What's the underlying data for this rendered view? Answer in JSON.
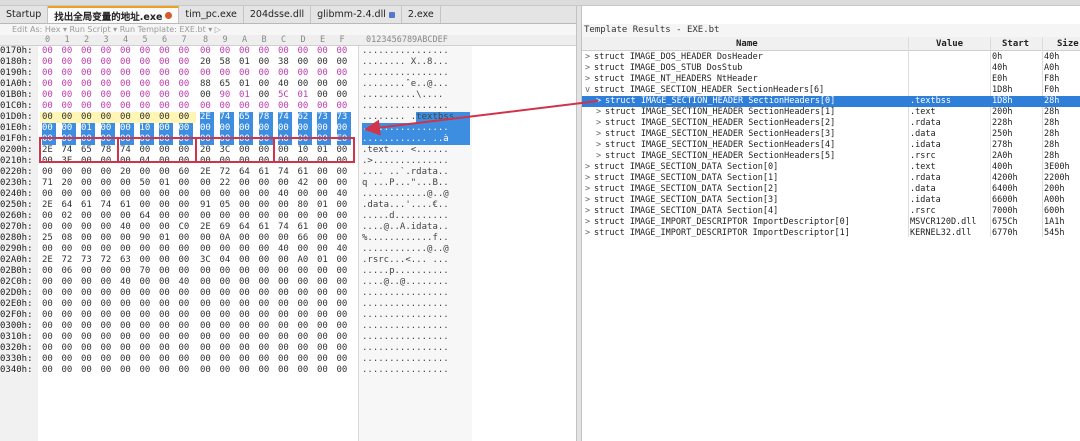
{
  "tabs": [
    {
      "label": "Startup",
      "active": false
    },
    {
      "label": "找出全局变量的地址.exe",
      "active": true
    },
    {
      "label": "tim_pc.exe",
      "active": false
    },
    {
      "label": "204dsse.dll",
      "active": false
    },
    {
      "label": "glibmm-2.4.dll",
      "active": false
    },
    {
      "label": "2.exe",
      "active": false
    }
  ],
  "edit_line": "Edit As: Hex ▾   Run Script ▾   Run Template: EXE.bt ▾  ▷",
  "hex_columns": [
    "0",
    "1",
    "2",
    "3",
    "4",
    "5",
    "6",
    "7",
    "8",
    "9",
    "A",
    "B",
    "C",
    "D",
    "E",
    "F"
  ],
  "ascii_header": "0123456789ABCDEF",
  "hex_rows": [
    {
      "addr": "0170h:",
      "bytes": [
        "00",
        "00",
        "00",
        "00",
        "00",
        "00",
        "00",
        "00",
        "00",
        "00",
        "00",
        "00",
        "00",
        "00",
        "00",
        "00"
      ],
      "ascii": "................"
    },
    {
      "addr": "0180h:",
      "bytes": [
        "00",
        "00",
        "00",
        "00",
        "00",
        "00",
        "00",
        "00",
        "20",
        "58",
        "01",
        "00",
        "38",
        "00",
        "00",
        "00"
      ],
      "ascii": "........ X..8..."
    },
    {
      "addr": "0190h:",
      "bytes": [
        "00",
        "00",
        "00",
        "00",
        "00",
        "00",
        "00",
        "00",
        "00",
        "00",
        "00",
        "00",
        "00",
        "00",
        "00",
        "00"
      ],
      "ascii": "................"
    },
    {
      "addr": "01A0h:",
      "bytes": [
        "00",
        "00",
        "00",
        "00",
        "00",
        "00",
        "00",
        "00",
        "88",
        "65",
        "01",
        "00",
        "40",
        "00",
        "00",
        "00"
      ],
      "ascii": "........ˆe..@..."
    },
    {
      "addr": "01B0h:",
      "bytes": [
        "00",
        "00",
        "00",
        "00",
        "00",
        "00",
        "00",
        "00",
        "00",
        "90",
        "01",
        "00",
        "5C",
        "01",
        "00",
        "00"
      ],
      "ascii": "..........\\...."
    },
    {
      "addr": "01C0h:",
      "bytes": [
        "00",
        "00",
        "00",
        "00",
        "00",
        "00",
        "00",
        "00",
        "00",
        "00",
        "00",
        "00",
        "00",
        "00",
        "00",
        "00"
      ],
      "ascii": "................"
    },
    {
      "addr": "01D0h:",
      "bytes": [
        "00",
        "00",
        "00",
        "00",
        "00",
        "00",
        "00",
        "00",
        "2E",
        "74",
        "65",
        "78",
        "74",
        "62",
        "73",
        "73"
      ],
      "ascii": "........ .textbss"
    },
    {
      "addr": "01E0h:",
      "bytes": [
        "00",
        "00",
        "01",
        "00",
        "00",
        "10",
        "00",
        "00",
        "00",
        "00",
        "00",
        "00",
        "00",
        "00",
        "00",
        "00"
      ],
      "ascii": "................"
    },
    {
      "addr": "01F0h:",
      "bytes": [
        "00",
        "00",
        "00",
        "00",
        "00",
        "00",
        "00",
        "00",
        "00",
        "00",
        "00",
        "00",
        "A0",
        "00",
        "00",
        "E0"
      ],
      "ascii": "............ ..à"
    },
    {
      "addr": "0200h:",
      "bytes": [
        "2E",
        "74",
        "65",
        "78",
        "74",
        "00",
        "00",
        "00",
        "20",
        "3C",
        "00",
        "00",
        "00",
        "10",
        "01",
        "00"
      ],
      "ascii": ".text... <......"
    },
    {
      "addr": "0210h:",
      "bytes": [
        "00",
        "3E",
        "00",
        "00",
        "00",
        "04",
        "00",
        "00",
        "00",
        "00",
        "00",
        "00",
        "00",
        "00",
        "00",
        "00"
      ],
      "ascii": ".>.............."
    },
    {
      "addr": "0220h:",
      "bytes": [
        "00",
        "00",
        "00",
        "00",
        "20",
        "00",
        "00",
        "60",
        "2E",
        "72",
        "64",
        "61",
        "74",
        "61",
        "00",
        "00"
      ],
      "ascii": ".... ..`.rdata.."
    },
    {
      "addr": "0230h:",
      "bytes": [
        "71",
        "20",
        "00",
        "00",
        "00",
        "50",
        "01",
        "00",
        "00",
        "22",
        "00",
        "00",
        "00",
        "42",
        "00",
        "00"
      ],
      "ascii": "q ...P...\"...B.."
    },
    {
      "addr": "0240h:",
      "bytes": [
        "00",
        "00",
        "00",
        "00",
        "00",
        "00",
        "00",
        "00",
        "00",
        "00",
        "00",
        "00",
        "40",
        "00",
        "00",
        "40"
      ],
      "ascii": "............@..@"
    },
    {
      "addr": "0250h:",
      "bytes": [
        "2E",
        "64",
        "61",
        "74",
        "61",
        "00",
        "00",
        "00",
        "91",
        "05",
        "00",
        "00",
        "00",
        "80",
        "01",
        "00"
      ],
      "ascii": ".data...'....€.."
    },
    {
      "addr": "0260h:",
      "bytes": [
        "00",
        "02",
        "00",
        "00",
        "00",
        "64",
        "00",
        "00",
        "00",
        "00",
        "00",
        "00",
        "00",
        "00",
        "00",
        "00"
      ],
      "ascii": ".....d.........."
    },
    {
      "addr": "0270h:",
      "bytes": [
        "00",
        "00",
        "00",
        "00",
        "40",
        "00",
        "00",
        "C0",
        "2E",
        "69",
        "64",
        "61",
        "74",
        "61",
        "00",
        "00"
      ],
      "ascii": "....@..À.idata.."
    },
    {
      "addr": "0280h:",
      "bytes": [
        "25",
        "08",
        "00",
        "00",
        "00",
        "90",
        "01",
        "00",
        "00",
        "0A",
        "00",
        "00",
        "00",
        "66",
        "00",
        "00"
      ],
      "ascii": "%............f.."
    },
    {
      "addr": "0290h:",
      "bytes": [
        "00",
        "00",
        "00",
        "00",
        "00",
        "00",
        "00",
        "00",
        "00",
        "00",
        "00",
        "00",
        "40",
        "00",
        "00",
        "40"
      ],
      "ascii": "............@..@"
    },
    {
      "addr": "02A0h:",
      "bytes": [
        "2E",
        "72",
        "73",
        "72",
        "63",
        "00",
        "00",
        "00",
        "3C",
        "04",
        "00",
        "00",
        "00",
        "A0",
        "01",
        "00"
      ],
      "ascii": ".rsrc...<... ..."
    },
    {
      "addr": "02B0h:",
      "bytes": [
        "00",
        "06",
        "00",
        "00",
        "00",
        "70",
        "00",
        "00",
        "00",
        "00",
        "00",
        "00",
        "00",
        "00",
        "00",
        "00"
      ],
      "ascii": ".....p.........."
    },
    {
      "addr": "02C0h:",
      "bytes": [
        "00",
        "00",
        "00",
        "00",
        "40",
        "00",
        "00",
        "40",
        "00",
        "00",
        "00",
        "00",
        "00",
        "00",
        "00",
        "00"
      ],
      "ascii": "....@..@........"
    },
    {
      "addr": "02D0h:",
      "bytes": [
        "00",
        "00",
        "00",
        "00",
        "00",
        "00",
        "00",
        "00",
        "00",
        "00",
        "00",
        "00",
        "00",
        "00",
        "00",
        "00"
      ],
      "ascii": "................"
    },
    {
      "addr": "02E0h:",
      "bytes": [
        "00",
        "00",
        "00",
        "00",
        "00",
        "00",
        "00",
        "00",
        "00",
        "00",
        "00",
        "00",
        "00",
        "00",
        "00",
        "00"
      ],
      "ascii": "................"
    },
    {
      "addr": "02F0h:",
      "bytes": [
        "00",
        "00",
        "00",
        "00",
        "00",
        "00",
        "00",
        "00",
        "00",
        "00",
        "00",
        "00",
        "00",
        "00",
        "00",
        "00"
      ],
      "ascii": "................"
    },
    {
      "addr": "0300h:",
      "bytes": [
        "00",
        "00",
        "00",
        "00",
        "00",
        "00",
        "00",
        "00",
        "00",
        "00",
        "00",
        "00",
        "00",
        "00",
        "00",
        "00"
      ],
      "ascii": "................"
    },
    {
      "addr": "0310h:",
      "bytes": [
        "00",
        "00",
        "00",
        "00",
        "00",
        "00",
        "00",
        "00",
        "00",
        "00",
        "00",
        "00",
        "00",
        "00",
        "00",
        "00"
      ],
      "ascii": "................"
    },
    {
      "addr": "0320h:",
      "bytes": [
        "00",
        "00",
        "00",
        "00",
        "00",
        "00",
        "00",
        "00",
        "00",
        "00",
        "00",
        "00",
        "00",
        "00",
        "00",
        "00"
      ],
      "ascii": "................"
    },
    {
      "addr": "0330h:",
      "bytes": [
        "00",
        "00",
        "00",
        "00",
        "00",
        "00",
        "00",
        "00",
        "00",
        "00",
        "00",
        "00",
        "00",
        "00",
        "00",
        "00"
      ],
      "ascii": "................"
    },
    {
      "addr": "0340h:",
      "bytes": [
        "00",
        "00",
        "00",
        "00",
        "00",
        "00",
        "00",
        "00",
        "00",
        "00",
        "00",
        "00",
        "00",
        "00",
        "00",
        "00"
      ],
      "ascii": "................"
    }
  ],
  "template_panel": {
    "title": "Template Results - EXE.bt",
    "columns": {
      "name": "Name",
      "value": "Value",
      "start": "Start",
      "size": "Size"
    },
    "rows": [
      {
        "caret": ">",
        "indent": 0,
        "name": "struct IMAGE_DOS_HEADER DosHeader",
        "value": "",
        "start": "0h",
        "size": "40h",
        "selected": false
      },
      {
        "caret": ">",
        "indent": 0,
        "name": "struct IMAGE_DOS_STUB DosStub",
        "value": "",
        "start": "40h",
        "size": "A0h",
        "selected": false
      },
      {
        "caret": ">",
        "indent": 0,
        "name": "struct IMAGE_NT_HEADERS NtHeader",
        "value": "",
        "start": "E0h",
        "size": "F8h",
        "selected": false
      },
      {
        "caret": "v",
        "indent": 0,
        "name": "struct IMAGE_SECTION_HEADER SectionHeaders[6]",
        "value": "",
        "start": "1D8h",
        "size": "F0h",
        "selected": false
      },
      {
        "caret": ">",
        "indent": 1,
        "name": "struct IMAGE_SECTION_HEADER SectionHeaders[0]",
        "value": ".textbss",
        "start": "1D8h",
        "size": "28h",
        "selected": true
      },
      {
        "caret": ">",
        "indent": 1,
        "name": "struct IMAGE_SECTION_HEADER SectionHeaders[1]",
        "value": ".text",
        "start": "200h",
        "size": "28h",
        "selected": false
      },
      {
        "caret": ">",
        "indent": 1,
        "name": "struct IMAGE_SECTION_HEADER SectionHeaders[2]",
        "value": ".rdata",
        "start": "228h",
        "size": "28h",
        "selected": false
      },
      {
        "caret": ">",
        "indent": 1,
        "name": "struct IMAGE_SECTION_HEADER SectionHeaders[3]",
        "value": ".data",
        "start": "250h",
        "size": "28h",
        "selected": false
      },
      {
        "caret": ">",
        "indent": 1,
        "name": "struct IMAGE_SECTION_HEADER SectionHeaders[4]",
        "value": ".idata",
        "start": "278h",
        "size": "28h",
        "selected": false
      },
      {
        "caret": ">",
        "indent": 1,
        "name": "struct IMAGE_SECTION_HEADER SectionHeaders[5]",
        "value": ".rsrc",
        "start": "2A0h",
        "size": "28h",
        "selected": false
      },
      {
        "caret": ">",
        "indent": 0,
        "name": "struct IMAGE_SECTION_DATA Section[0]",
        "value": ".text",
        "start": "400h",
        "size": "3E00h",
        "selected": false
      },
      {
        "caret": ">",
        "indent": 0,
        "name": "struct IMAGE_SECTION_DATA Section[1]",
        "value": ".rdata",
        "start": "4200h",
        "size": "2200h",
        "selected": false
      },
      {
        "caret": ">",
        "indent": 0,
        "name": "struct IMAGE_SECTION_DATA Section[2]",
        "value": ".data",
        "start": "6400h",
        "size": "200h",
        "selected": false
      },
      {
        "caret": ">",
        "indent": 0,
        "name": "struct IMAGE_SECTION_DATA Section[3]",
        "value": ".idata",
        "start": "6600h",
        "size": "A00h",
        "selected": false
      },
      {
        "caret": ">",
        "indent": 0,
        "name": "struct IMAGE_SECTION_DATA Section[4]",
        "value": ".rsrc",
        "start": "7000h",
        "size": "600h",
        "selected": false
      },
      {
        "caret": ">",
        "indent": 0,
        "name": "struct IMAGE_IMPORT_DESCRIPTOR ImportDescriptor[0]",
        "value": "MSVCR120D.dll",
        "start": "675Ch",
        "size": "1A1h",
        "selected": false
      },
      {
        "caret": ">",
        "indent": 0,
        "name": "struct IMAGE_IMPORT_DESCRIPTOR ImportDescriptor[1]",
        "value": "KERNEL32.dll",
        "start": "6770h",
        "size": "545h",
        "selected": false
      }
    ]
  },
  "colors": {
    "selection": "#3d8ee0",
    "pink_highlight": "#fbe0f6",
    "annotation_red": "#d0334a",
    "active_tab_accent": "#f0a020"
  }
}
